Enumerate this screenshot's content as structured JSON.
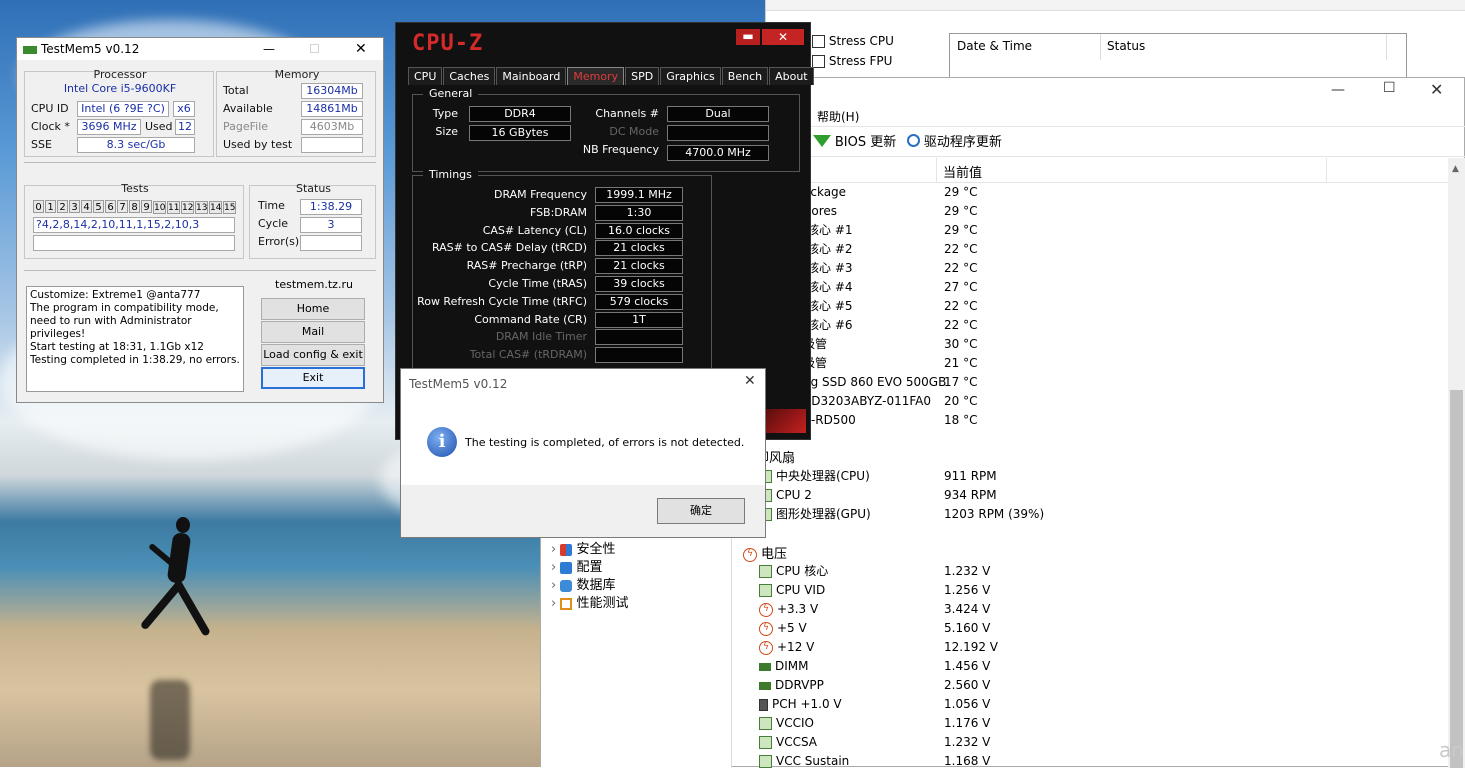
{
  "testmem": {
    "title": "TestMem5 v0.12",
    "processor": {
      "heading": "Processor",
      "name": "Intel Core i5-9600KF",
      "cpuid_label": "CPU ID",
      "cpuid_value": "Intel (6 ?9E ?C)",
      "cores": "x6",
      "clock_label": "Clock *",
      "clock_value": "3696 MHz",
      "used_label": "Used",
      "used_value": "12",
      "sse_label": "SSE",
      "sse_value": "8.3 sec/Gb"
    },
    "memory": {
      "heading": "Memory",
      "total_label": "Total",
      "total_value": "16304Mb",
      "available_label": "Available",
      "available_value": "14861Mb",
      "pagefile_label": "PageFile",
      "pagefile_value": "4603Mb",
      "usedbytest_label": "Used by test",
      "usedbytest_value": ""
    },
    "tests": {
      "heading": "Tests",
      "cells": [
        "0",
        "1",
        "2",
        "3",
        "4",
        "5",
        "6",
        "7",
        "8",
        "9",
        "10",
        "11",
        "12",
        "13",
        "14",
        "15"
      ],
      "sequence": "?4,2,8,14,2,10,11,1,15,2,10,3"
    },
    "status": {
      "heading": "Status",
      "time_label": "Time",
      "time_value": "1:38.29",
      "cycle_label": "Cycle",
      "cycle_value": "3",
      "errors_label": "Error(s)",
      "errors_value": ""
    },
    "log": [
      "Customize: Extreme1 @anta777",
      "The program in compatibility mode,",
      "need to run with Administrator privileges!",
      "Start testing at 18:31, 1.1Gb x12",
      "Testing completed in 1:38.29, no errors."
    ],
    "site": "testmem.tz.ru",
    "buttons": {
      "home": "Home",
      "mail": "Mail",
      "load": "Load config & exit",
      "exit": "Exit"
    }
  },
  "cpuz": {
    "logo": "CPU-Z",
    "tabs": [
      "CPU",
      "Caches",
      "Mainboard",
      "Memory",
      "SPD",
      "Graphics",
      "Bench",
      "About"
    ],
    "selected_tab": "Memory",
    "general": {
      "heading": "General",
      "type_label": "Type",
      "type_value": "DDR4",
      "size_label": "Size",
      "size_value": "16 GBytes",
      "channels_label": "Channels #",
      "channels_value": "Dual",
      "dcmode_label": "DC Mode",
      "dcmode_value": "",
      "nbfreq_label": "NB Frequency",
      "nbfreq_value": "4700.0 MHz"
    },
    "timings": {
      "heading": "Timings",
      "rows": [
        {
          "label": "DRAM Frequency",
          "value": "1999.1 MHz",
          "dim": false
        },
        {
          "label": "FSB:DRAM",
          "value": "1:30",
          "dim": false
        },
        {
          "label": "CAS# Latency (CL)",
          "value": "16.0 clocks",
          "dim": false
        },
        {
          "label": "RAS# to CAS# Delay (tRCD)",
          "value": "21 clocks",
          "dim": false
        },
        {
          "label": "RAS# Precharge (tRP)",
          "value": "21 clocks",
          "dim": false
        },
        {
          "label": "Cycle Time (tRAS)",
          "value": "39 clocks",
          "dim": false
        },
        {
          "label": "Row Refresh Cycle Time (tRFC)",
          "value": "579 clocks",
          "dim": false
        },
        {
          "label": "Command Rate (CR)",
          "value": "1T",
          "dim": false
        },
        {
          "label": "DRAM Idle Timer",
          "value": "",
          "dim": true
        },
        {
          "label": "Total CAS# (tRDRAM)",
          "value": "",
          "dim": true
        }
      ]
    }
  },
  "stress": {
    "cpu": "Stress CPU",
    "fpu": "Stress FPU",
    "col_datetime": "Date & Time",
    "col_status": "Status"
  },
  "aida": {
    "menu_help": "帮助(H)",
    "toolbar": {
      "bios": "BIOS 更新",
      "driver": "驱动程序更新"
    },
    "col_value": "当前值",
    "temps": [
      {
        "label": "ackage",
        "value": "29 °C"
      },
      {
        "label": "Cores",
        "value": "29 °C"
      },
      {
        "label": "/核心 #1",
        "value": "29 °C"
      },
      {
        "label": "/核心 #2",
        "value": "22 °C"
      },
      {
        "label": "/核心 #3",
        "value": "22 °C"
      },
      {
        "label": "/核心 #4",
        "value": "27 °C"
      },
      {
        "label": "/核心 #5",
        "value": "22 °C"
      },
      {
        "label": "/核心 #6",
        "value": "22 °C"
      },
      {
        "label": "极管",
        "value": "30 °C"
      },
      {
        "label": "极管",
        "value": "21 °C"
      },
      {
        "label": "ng SSD 860 EVO 500GB",
        "value": "17 °C"
      },
      {
        "label": "VD3203ABYZ-011FA0",
        "value": "20 °C"
      },
      {
        "label": "A-RD500",
        "value": "18 °C"
      }
    ],
    "fans_heading": "冷却风扇",
    "fans": [
      {
        "label": "中央处理器(CPU)",
        "value": "911 RPM"
      },
      {
        "label": "CPU 2",
        "value": "934 RPM"
      },
      {
        "label": "图形处理器(GPU)",
        "value": "1203 RPM  (39%)"
      }
    ],
    "volt_heading": "电压",
    "volts": [
      {
        "label": "CPU 核心",
        "value": "1.232 V",
        "icon": "chip"
      },
      {
        "label": "CPU VID",
        "value": "1.256 V",
        "icon": "chip"
      },
      {
        "label": "+3.3 V",
        "value": "3.424 V",
        "icon": "bolt"
      },
      {
        "label": "+5 V",
        "value": "5.160 V",
        "icon": "bolt"
      },
      {
        "label": "+12 V",
        "value": "12.192 V",
        "icon": "bolt"
      },
      {
        "label": "DIMM",
        "value": "1.456 V",
        "icon": "ram"
      },
      {
        "label": "DDRVPP",
        "value": "2.560 V",
        "icon": "ram"
      },
      {
        "label": "PCH +1.0 V",
        "value": "1.056 V",
        "icon": "pch"
      },
      {
        "label": "VCCIO",
        "value": "1.176 V",
        "icon": "chip"
      },
      {
        "label": "VCCSA",
        "value": "1.232 V",
        "icon": "chip"
      },
      {
        "label": "VCC Sustain",
        "value": "1.168 V",
        "icon": "chip"
      }
    ],
    "tree": [
      "安全性",
      "配置",
      "数据库",
      "性能测试"
    ]
  },
  "msgbox": {
    "title": "TestMem5 v0.12",
    "text": "The testing is completed, of errors is not detected.",
    "ok": "确定"
  },
  "corner_text": "an"
}
